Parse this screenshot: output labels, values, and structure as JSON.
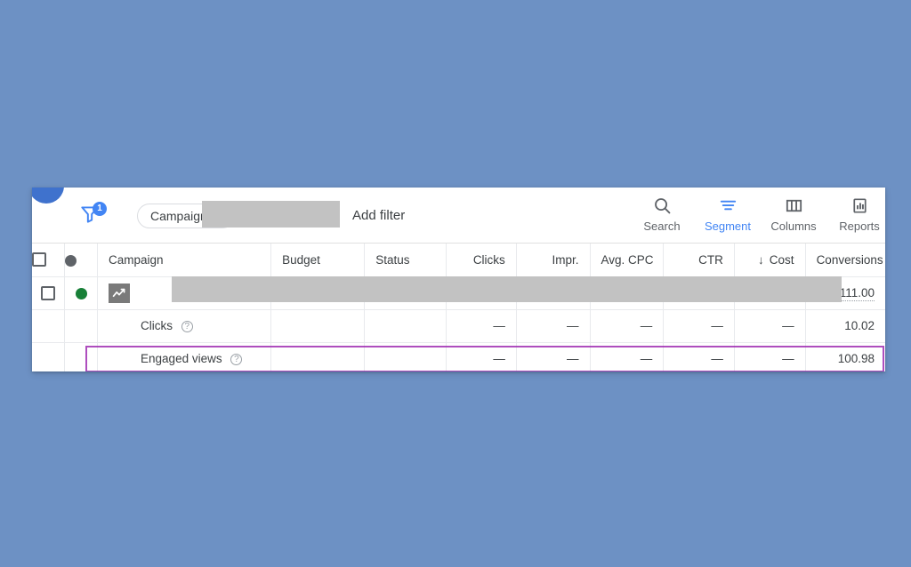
{
  "background_color": "#6d91c4",
  "accent_color": "#4285f4",
  "highlight_color": "#9c27b0",
  "toolbar": {
    "filter_badge_count": "1",
    "filter_chip_label": "Campaign",
    "add_filter_label": "Add filter",
    "actions": [
      {
        "label": "Search",
        "icon": "search-icon",
        "active": false
      },
      {
        "label": "Segment",
        "icon": "segment-icon",
        "active": true
      },
      {
        "label": "Columns",
        "icon": "columns-icon",
        "active": false
      },
      {
        "label": "Reports",
        "icon": "reports-icon",
        "active": false
      }
    ]
  },
  "table": {
    "headers": {
      "select": "",
      "status_dot": "",
      "campaign": "Campaign",
      "budget": "Budget",
      "status": "Status",
      "clicks": "Clicks",
      "impr": "Impr.",
      "avg_cpc": "Avg. CPC",
      "ctr": "CTR",
      "cost": "Cost",
      "cost_sort_arrow": "↓",
      "conversions": "Conversions"
    },
    "campaign_row": {
      "status": "enabled",
      "chart_icon": "trend-chart-icon",
      "name_redacted": true,
      "conversions": "111.00"
    },
    "segment_rows": [
      {
        "label": "Clicks",
        "help": "?",
        "budget": "",
        "status": "",
        "clicks": "—",
        "impr": "—",
        "avg_cpc": "—",
        "ctr": "—",
        "cost": "—",
        "conversions": "10.02",
        "highlighted": false
      },
      {
        "label": "Engaged views",
        "help": "?",
        "budget": "",
        "status": "",
        "clicks": "—",
        "impr": "—",
        "avg_cpc": "—",
        "ctr": "—",
        "cost": "—",
        "conversions": "100.98",
        "highlighted": true
      }
    ]
  }
}
